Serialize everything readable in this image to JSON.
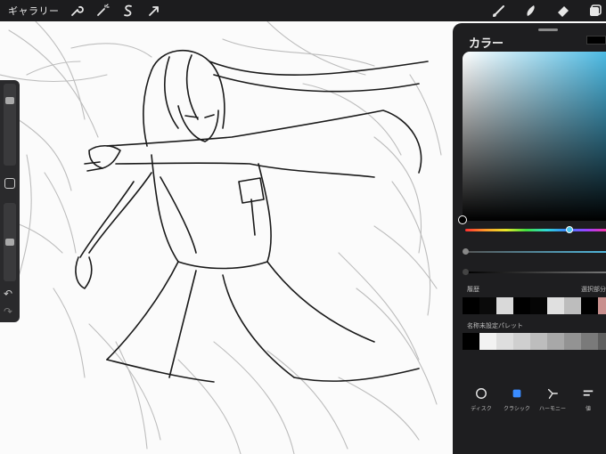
{
  "toolbar": {
    "gallery_label": "ギャラリー",
    "left_icons": [
      "wrench-icon",
      "magic-wand-icon",
      "selection-icon",
      "transform-arrow-icon"
    ],
    "right_icons": [
      "brush-icon",
      "smudge-icon",
      "eraser-icon",
      "layers-icon"
    ]
  },
  "sidebar": {
    "brush_size_level": 0.15,
    "opacity_level": 0.5,
    "undo_icon": "undo-icon",
    "redo_icon": "redo-icon"
  },
  "color_panel": {
    "title": "カラー",
    "current_color": "#000000",
    "hue_color": "#49b9e3",
    "history_label": "履歴",
    "selected_label": "選択部分",
    "history_swatches": [
      "#000000",
      "#0a0a0a",
      "#d9d9d9",
      "#000000",
      "#050505",
      "#e0e0e0",
      "#bdbdbd",
      "#000000",
      "#c9908e"
    ],
    "palette_label": "名称未設定パレット",
    "palette_swatches": [
      "#000000",
      "#f2f2f2",
      "#dedede",
      "#cfcfcf",
      "#bdbdbd",
      "#a8a8a8",
      "#939393",
      "#7a7a7a",
      "#5e5e5e"
    ],
    "modes": [
      {
        "label": "ディスク",
        "icon": "disc-icon"
      },
      {
        "label": "クラシック",
        "icon": "classic-square-icon"
      },
      {
        "label": "ハーモニー",
        "icon": "harmony-icon"
      },
      {
        "label": "値",
        "icon": "value-sliders-icon"
      }
    ]
  }
}
